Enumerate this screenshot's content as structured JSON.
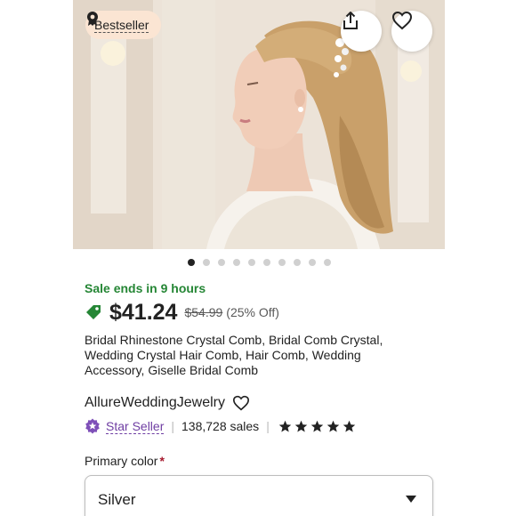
{
  "hero": {
    "badge_label": "Bestseller",
    "badge_icon": "award-ribbon-icon",
    "share_icon": "share-icon",
    "favorite_icon": "heart-outline-icon",
    "image_count": 10,
    "active_image_index": 0
  },
  "listing": {
    "sale_text": "Sale ends in 9 hours",
    "sale_color": "#258635",
    "price": "$41.24",
    "original_price": "$54.99",
    "discount": "(25% Off)",
    "title": "Bridal Rhinestone Crystal Comb, Bridal Comb Crystal, Wedding Crystal Hair Comb, Hair Comb, Wedding Accessory, Giselle Bridal Comb"
  },
  "shop": {
    "name": "AllureWeddingJewelry",
    "follow_icon": "heart-outline-icon",
    "star_seller_label": "Star Seller",
    "star_seller_color": "#6f3ea3",
    "sales_text": "138,728 sales",
    "rating_stars": 5
  },
  "options": {
    "primary_color_label": "Primary color",
    "required_marker": "*",
    "selected_value": "Silver"
  }
}
